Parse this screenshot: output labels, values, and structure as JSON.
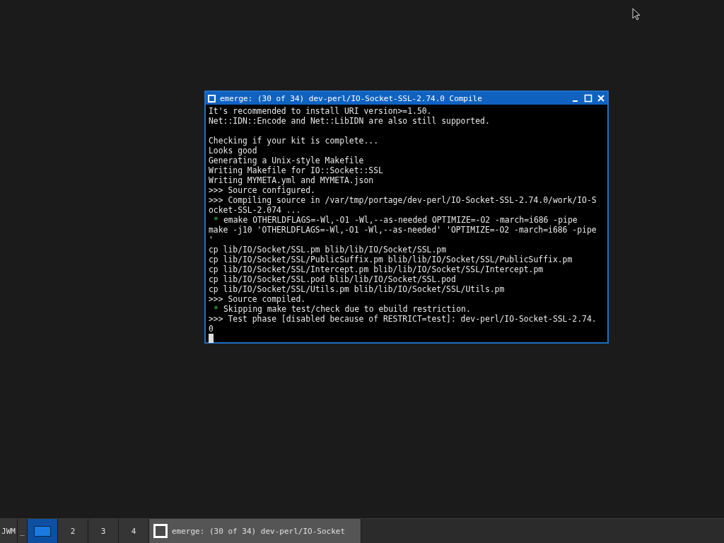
{
  "window": {
    "title": "emerge: (30 of 34) dev-perl/IO-Socket-SSL-2.74.0 Compile",
    "active": true
  },
  "terminal": {
    "lines": [
      {
        "kind": "plain",
        "text": "It's recommended to install URI version>=1.50."
      },
      {
        "kind": "plain",
        "text": "Net::IDN::Encode and Net::LibIDN are also still supported."
      },
      {
        "kind": "blank"
      },
      {
        "kind": "plain",
        "text": "Checking if your kit is complete..."
      },
      {
        "kind": "plain",
        "text": "Looks good"
      },
      {
        "kind": "plain",
        "text": "Generating a Unix-style Makefile"
      },
      {
        "kind": "plain",
        "text": "Writing Makefile for IO::Socket::SSL"
      },
      {
        "kind": "plain",
        "text": "Writing MYMETA.yml and MYMETA.json"
      },
      {
        "kind": "plain",
        "text": ">>> Source configured."
      },
      {
        "kind": "plain",
        "text": ">>> Compiling source in /var/tmp/portage/dev-perl/IO-Socket-SSL-2.74.0/work/IO-S"
      },
      {
        "kind": "plain",
        "text": "ocket-SSL-2.074 ..."
      },
      {
        "kind": "notice",
        "marker": "*",
        "text": "emake OTHERLDFLAGS=-Wl,-O1 -Wl,--as-needed OPTIMIZE=-O2 -march=i686 -pipe"
      },
      {
        "kind": "plain",
        "text": "make -j10 'OTHERLDFLAGS=-Wl,-O1 -Wl,--as-needed' 'OPTIMIZE=-O2 -march=i686 -pipe"
      },
      {
        "kind": "plain",
        "text": "'"
      },
      {
        "kind": "plain",
        "text": "cp lib/IO/Socket/SSL.pm blib/lib/IO/Socket/SSL.pm"
      },
      {
        "kind": "plain",
        "text": "cp lib/IO/Socket/SSL/PublicSuffix.pm blib/lib/IO/Socket/SSL/PublicSuffix.pm"
      },
      {
        "kind": "plain",
        "text": "cp lib/IO/Socket/SSL/Intercept.pm blib/lib/IO/Socket/SSL/Intercept.pm"
      },
      {
        "kind": "plain",
        "text": "cp lib/IO/Socket/SSL.pod blib/lib/IO/Socket/SSL.pod"
      },
      {
        "kind": "plain",
        "text": "cp lib/IO/Socket/SSL/Utils.pm blib/lib/IO/Socket/SSL/Utils.pm"
      },
      {
        "kind": "plain",
        "text": ">>> Source compiled."
      },
      {
        "kind": "notice",
        "marker": "*",
        "text": "Skipping make test/check due to ebuild restriction."
      },
      {
        "kind": "plain",
        "text": ">>> Test phase [disabled because of RESTRICT=test]: dev-perl/IO-Socket-SSL-2.74."
      },
      {
        "kind": "plain",
        "text": "0"
      },
      {
        "kind": "cursor"
      }
    ]
  },
  "taskbar": {
    "menu_button": "JWM",
    "minimize_button": "_",
    "desktops": [
      {
        "selected": true
      },
      {
        "label": "2",
        "selected": false
      },
      {
        "label": "3",
        "selected": false
      },
      {
        "label": "4",
        "selected": false
      }
    ],
    "tasks": [
      {
        "title": "emerge: (30 of 34) dev-perl/IO-Socket",
        "selected": true
      }
    ]
  }
}
